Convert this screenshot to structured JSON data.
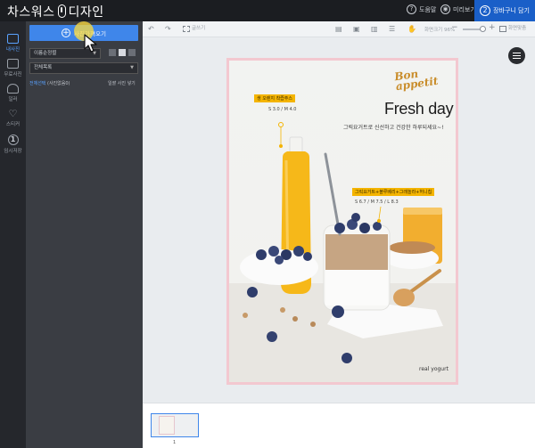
{
  "app": {
    "logo_text_left": "차스워스",
    "logo_text_right": "디자인"
  },
  "header": {
    "help_label": "도움말",
    "preview_label": "미리보기",
    "cart_step": "2",
    "cart_label": "장바구니 담기"
  },
  "rail": {
    "items": [
      {
        "label": "내사진",
        "icon": "image-icon"
      },
      {
        "label": "무료사진",
        "icon": "photo-library-icon"
      },
      {
        "label": "일러",
        "icon": "shapes-icon"
      },
      {
        "label": "스티커",
        "icon": "heart-icon"
      },
      {
        "label": "임시저장",
        "icon": "save-icon",
        "glyph": "1"
      }
    ]
  },
  "panel": {
    "upload_label": "사진가져오기",
    "sort_value": "이름순정렬",
    "category_value": "전체목록",
    "select_all_label": "전체선택",
    "photo_count_label": "(사진없음0)",
    "show_used_label": "일괄 사진 넣기"
  },
  "toolbar": {
    "grid_label": "글쓰기",
    "zoom_label": "화면크기 96%",
    "fit_label": "화면맞춤"
  },
  "page": {
    "brand_line1": "Bon",
    "brand_line2": "appetit",
    "headline": "Fresh day",
    "tagline": "그릭요거트로 신선하고 건강한 하루되세요~!",
    "tag1_title": "생 오렌지 착즙주스",
    "tag1_price": "S 3.0 / M 4.0",
    "tag2_title": "그릭요거트+블루베리+그래놀라+허니칩",
    "tag2_price": "S 6.7 / M 7.5 / L 8.3",
    "signature": "real yogurt"
  },
  "thumbs": {
    "page_number": "1"
  },
  "colors": {
    "accent": "#3f86ea",
    "cart": "#1a5fc8",
    "tag": "#f4b400"
  }
}
